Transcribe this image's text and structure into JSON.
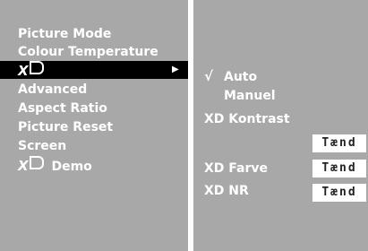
{
  "left_menu": {
    "items": [
      {
        "label": "Picture Mode"
      },
      {
        "label": "Colour Temperature"
      },
      {
        "label": "XD"
      },
      {
        "label": "Advanced"
      },
      {
        "label": "Aspect Ratio"
      },
      {
        "label": "Picture Reset"
      },
      {
        "label": "Screen"
      },
      {
        "label": "XD Demo",
        "suffix": "Demo"
      }
    ],
    "selected_index": 2,
    "submenu_arrow": "▶"
  },
  "right_menu": {
    "check_mark": "√",
    "auto_label": "Auto",
    "manual_label": "Manuel",
    "contrast_label": "XD Kontrast",
    "contrast_value": "Tænd",
    "color_label": "XD Farve",
    "color_value": "Tænd",
    "nr_label": "XD NR",
    "nr_value": "Tænd"
  },
  "colors": {
    "panel": "#a8a8a8",
    "background": "#ffffff",
    "selected": "#000000",
    "text": "#ffffff"
  }
}
